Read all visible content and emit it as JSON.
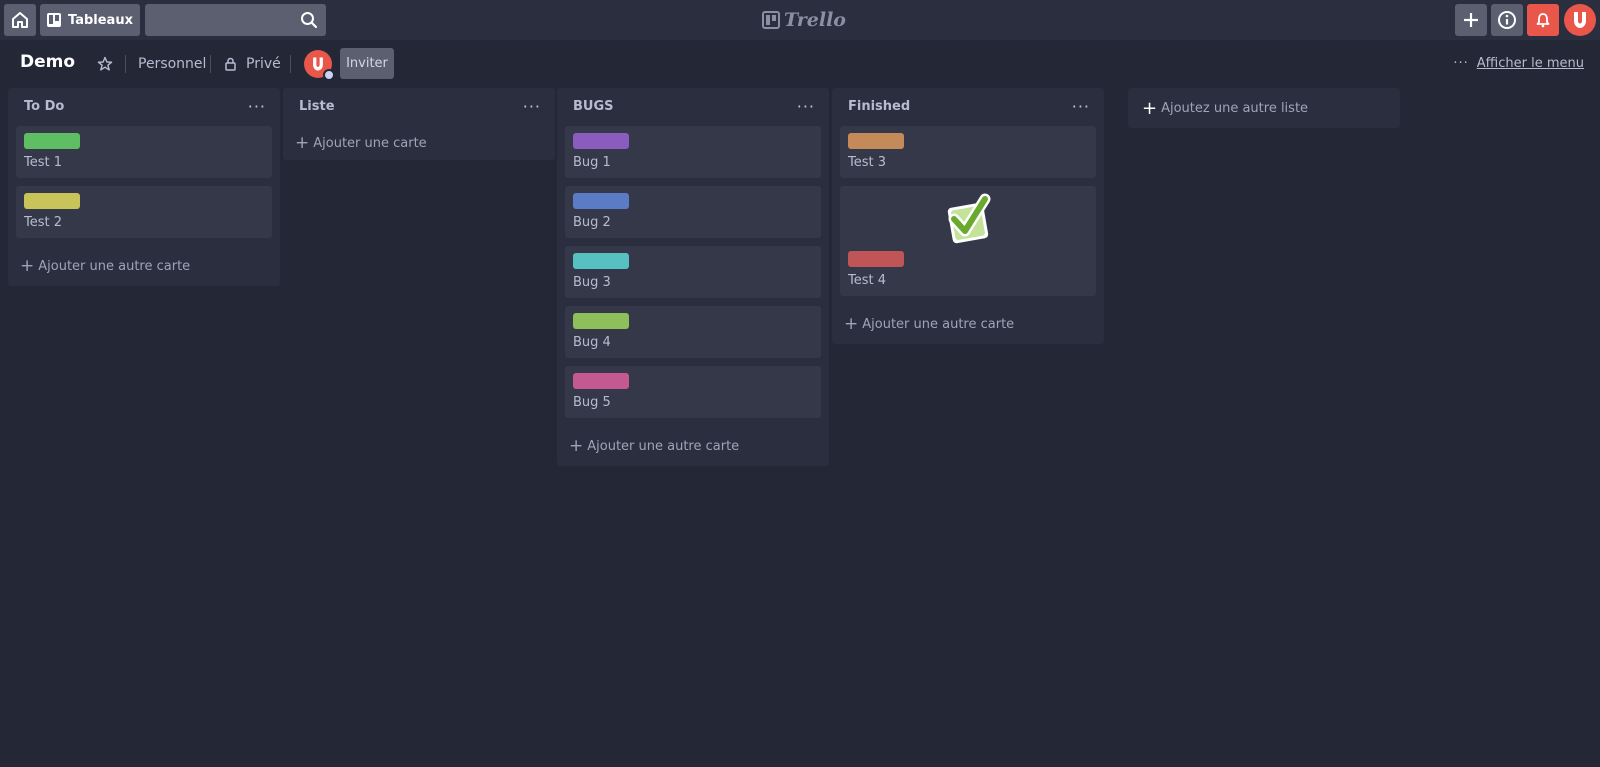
{
  "header": {
    "boards_label": "Tableaux",
    "logo_text": "Trello",
    "home_icon": "home-icon",
    "search_icon": "search-icon",
    "add_icon": "plus-icon",
    "info_icon": "info-icon",
    "bell_icon": "bell-icon",
    "bell_color": "#e8574a"
  },
  "board": {
    "title": "Demo",
    "team": "Personnel",
    "visibility": "Privé",
    "invite_label": "Inviter",
    "menu_label": "Afficher le menu"
  },
  "lists": [
    {
      "title": "To Do",
      "cards": [
        {
          "label_color": "#5fbe63",
          "title": "Test 1"
        },
        {
          "label_color": "#c9c45a",
          "title": "Test 2"
        }
      ],
      "add_label": "Ajouter une autre carte"
    },
    {
      "title": "Liste",
      "cards": [],
      "add_label": "Ajouter une carte"
    },
    {
      "title": "BUGS",
      "cards": [
        {
          "label_color": "#8b5cc0",
          "title": "Bug 1"
        },
        {
          "label_color": "#5b7cc4",
          "title": "Bug 2"
        },
        {
          "label_color": "#56c1c0",
          "title": "Bug 3"
        },
        {
          "label_color": "#8dbf5a",
          "title": "Bug 4"
        },
        {
          "label_color": "#c35991",
          "title": "Bug 5"
        }
      ],
      "add_label": "Ajouter une autre carte"
    },
    {
      "title": "Finished",
      "cards": [
        {
          "label_color": "#c48a5a",
          "title": "Test 3"
        },
        {
          "label_color": "#c05557",
          "title": "Test 4",
          "sticker": "check-sticker-icon"
        }
      ],
      "add_label": "Ajouter une autre carte"
    }
  ],
  "add_list_label": "Ajoutez une autre liste"
}
